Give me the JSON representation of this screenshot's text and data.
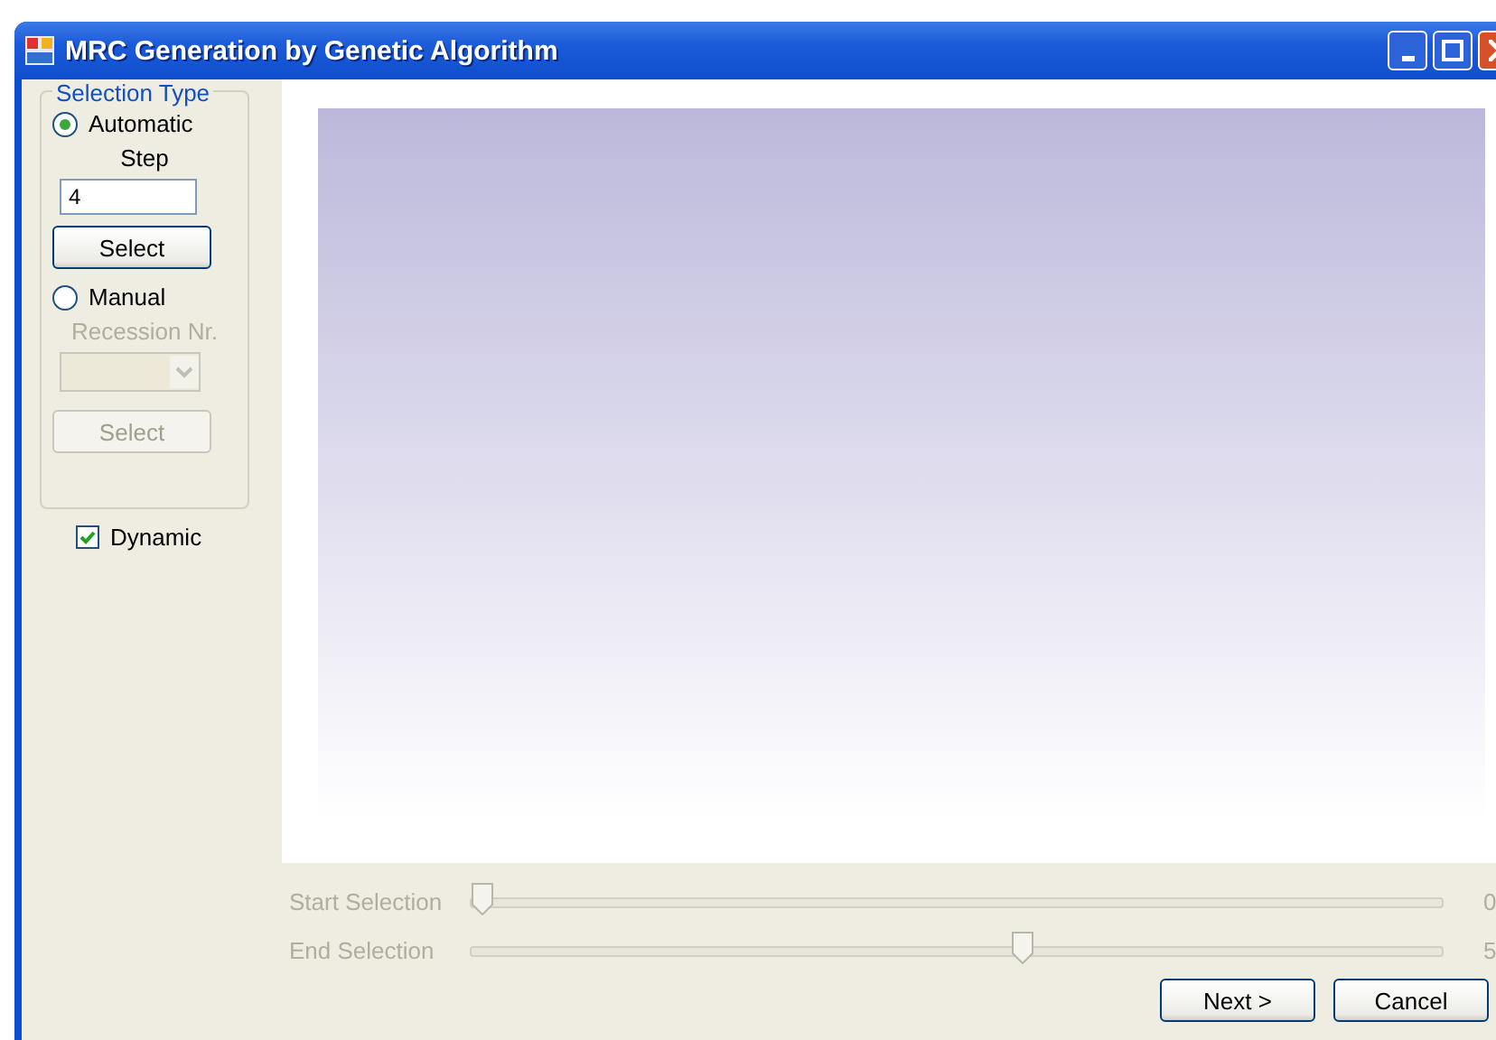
{
  "window": {
    "title": "MRC Generation by Genetic Algorithm"
  },
  "selection_type": {
    "title": "Selection Type",
    "automatic": {
      "label": "Automatic",
      "selected": true,
      "step_label": "Step",
      "step_value": "4",
      "button": {
        "label": "Select",
        "disabled": false
      }
    },
    "manual": {
      "label": "Manual",
      "selected": false,
      "recession_label": "Recession Nr.",
      "disabled": true,
      "button": {
        "label": "Select",
        "disabled": true
      }
    }
  },
  "dynamic": {
    "label": "Dynamic",
    "checked": true
  },
  "sliders": [
    {
      "label": "Start Selection",
      "level": 0,
      "reading": "0",
      "disabled": true
    },
    {
      "label": "End Selection",
      "level": 0.57,
      "reading": "5",
      "disabled": true
    }
  ],
  "buttons": [
    {
      "label": "Next >"
    },
    {
      "label": "Cancel"
    }
  ]
}
